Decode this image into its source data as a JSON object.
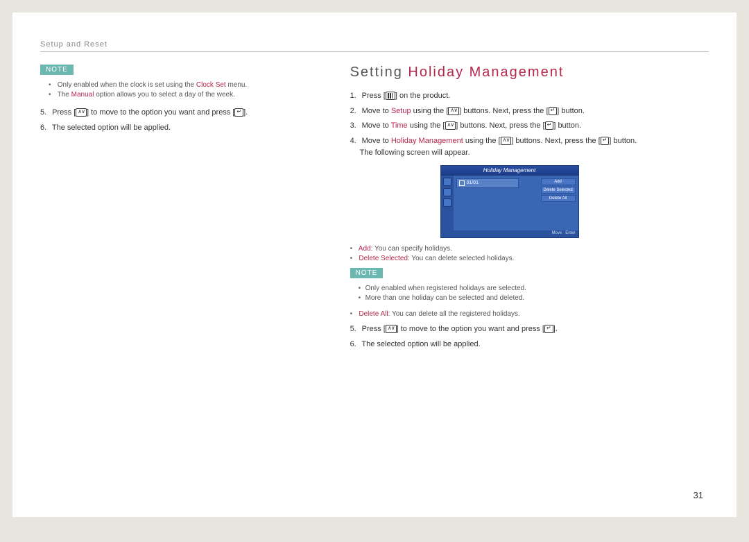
{
  "breadcrumb": "Setup and Reset",
  "noteLabel": "NOTE",
  "left": {
    "note1": {
      "pre": "Only enabled when the clock is set using the ",
      "accent": "Clock Set",
      "post": " menu."
    },
    "note2": {
      "pre": "The ",
      "accent": "Manual",
      "post": " option allows you to select a day of the week."
    },
    "step5": {
      "num": "5.",
      "a": "Press [",
      "b": "] to move to the option you want and press [",
      "c": "]."
    },
    "step6": {
      "num": "6.",
      "text": "The selected option will be applied."
    }
  },
  "right": {
    "heading_dark": "Setting ",
    "heading_accent": "Holiday Management",
    "step1": {
      "num": "1.",
      "a": "Press [",
      "b": "] on the product."
    },
    "step2": {
      "num": "2.",
      "a": "Move to ",
      "accent": "Setup",
      "b": " using the [",
      "c": "] buttons. Next, press the [",
      "d": "] button."
    },
    "step3": {
      "num": "3.",
      "a": "Move to ",
      "accent": "Time",
      "b": " using the [",
      "c": "] buttons. Next, press the [",
      "d": "] button."
    },
    "step4": {
      "num": "4.",
      "a": "Move to ",
      "accent": "Holiday Management",
      "b": " using the [",
      "c": "] buttons. Next, press the [",
      "d": "] button.",
      "tail": "The following screen will appear."
    },
    "osd": {
      "title": "Holiday Management",
      "date": "01/01",
      "btn_add": "Add",
      "btn_del_sel": "Delete Selected",
      "btn_del_all": "Delete All",
      "foot_move": "Move",
      "foot_enter": "Enter"
    },
    "desc_add": {
      "accent": "Add",
      "text": ": You can specify holidays."
    },
    "desc_del_sel": {
      "accent": "Delete Selected",
      "text": ": You can delete selected holidays."
    },
    "note1": "Only enabled when registered holidays are selected.",
    "note2": "More than one holiday can be selected and deleted.",
    "desc_del_all": {
      "accent": "Delete All",
      "text": ": You can delete all the registered holidays."
    },
    "step5": {
      "num": "5.",
      "a": "Press [",
      "b": "] to move to the option you want and press [",
      "c": "]."
    },
    "step6": {
      "num": "6.",
      "text": "The selected option will be applied."
    }
  },
  "pageNumber": "31"
}
